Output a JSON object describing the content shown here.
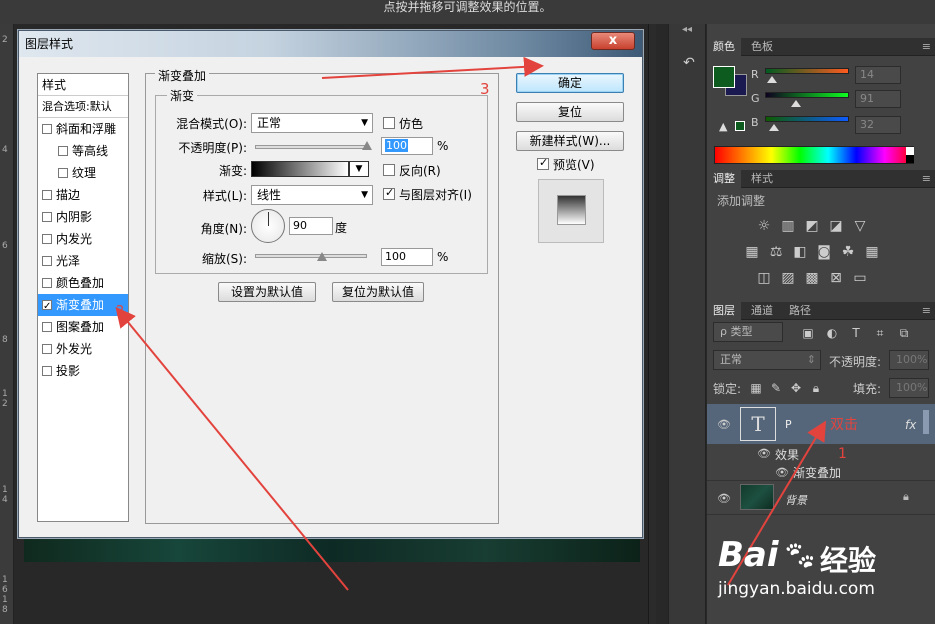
{
  "hint": "点按并拖移可调整效果的位置。",
  "ruler": [
    "2",
    "4",
    "6",
    "8",
    "1",
    "2",
    "1",
    "4",
    "1",
    "6",
    "1",
    "8"
  ],
  "color_panel": {
    "tabs": [
      "颜色",
      "色板"
    ],
    "labels": {
      "r": "R",
      "g": "G",
      "b": "B"
    },
    "values": {
      "r": "14",
      "g": "91",
      "b": "32"
    },
    "foreground": "#0e5b20",
    "background": "#1a1a50"
  },
  "adjust_panel": {
    "tabs": [
      "调整",
      "样式"
    ],
    "subtitle": "添加调整"
  },
  "layers_panel": {
    "tabs": [
      "图层",
      "通道",
      "路径"
    ],
    "filter_label": "ρ 类型",
    "blend": "正常",
    "opacity_label": "不透明度:",
    "opacity_value": "100%",
    "lock_label": "锁定:",
    "fill_label": "填充:",
    "fill_value": "100%",
    "layers": [
      {
        "name": "P",
        "fx": "fx",
        "thumb": "T"
      },
      {
        "name": "效果"
      },
      {
        "name": "渐变叠加"
      },
      {
        "name": "背景"
      }
    ]
  },
  "dialog": {
    "title": "图层样式",
    "close": "x",
    "styles_header": "样式",
    "blend_default": "混合选项:默认",
    "items": [
      {
        "label": "斜面和浮雕",
        "checked": false,
        "indent": false
      },
      {
        "label": "等高线",
        "checked": false,
        "indent": true
      },
      {
        "label": "纹理",
        "checked": false,
        "indent": true
      },
      {
        "label": "描边",
        "checked": false,
        "indent": false
      },
      {
        "label": "内阴影",
        "checked": false,
        "indent": false
      },
      {
        "label": "内发光",
        "checked": false,
        "indent": false
      },
      {
        "label": "光泽",
        "checked": false,
        "indent": false
      },
      {
        "label": "颜色叠加",
        "checked": false,
        "indent": false
      },
      {
        "label": "渐变叠加",
        "checked": true,
        "indent": false,
        "selected": true
      },
      {
        "label": "图案叠加",
        "checked": false,
        "indent": false
      },
      {
        "label": "外发光",
        "checked": false,
        "indent": false
      },
      {
        "label": "投影",
        "checked": false,
        "indent": false
      }
    ],
    "group_title": "渐变叠加",
    "sub_group_title": "渐变",
    "blend_mode_label": "混合模式(O):",
    "blend_mode_value": "正常",
    "dither_label": "仿色",
    "opacity_label": "不透明度(P):",
    "opacity_value": "100",
    "opacity_pct": 100,
    "percent": "%",
    "gradient_label": "渐变:",
    "reverse_label": "反向(R)",
    "style_label": "样式(L):",
    "style_value": "线性",
    "align_label": "与图层对齐(I)",
    "angle_label": "角度(N):",
    "angle_value": "90",
    "degree": "度",
    "scale_label": "缩放(S):",
    "scale_value": "100",
    "scale_pct": 100,
    "set_default": "设置为默认值",
    "reset_default": "复位为默认值",
    "ok": "确定",
    "reset": "复位",
    "new_style": "新建样式(W)...",
    "preview_label": "预览(V)"
  },
  "annotations": {
    "n1": "1",
    "n2": "2",
    "n3": "3",
    "dblclick": "双击"
  },
  "watermark": {
    "brand": "Bai",
    "brand_cn": "经验",
    "url": "jingyan.baidu.com"
  },
  "colors": {
    "accent": "#3399ff",
    "annotation": "#e3433d"
  }
}
